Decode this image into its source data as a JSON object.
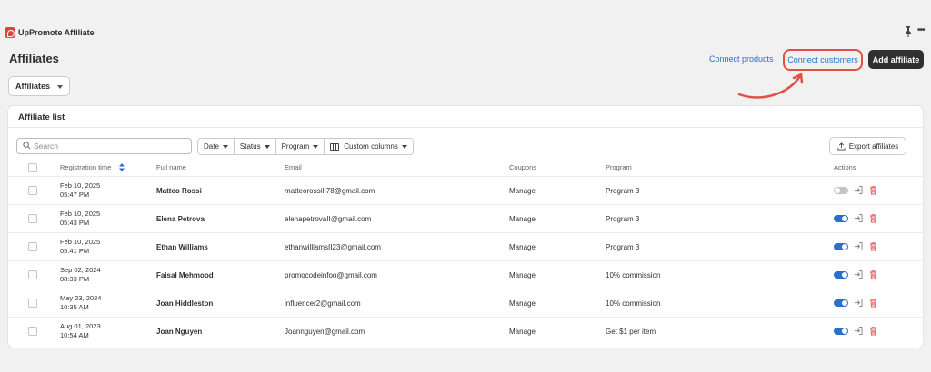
{
  "app": {
    "name": "UpPromote Affiliate",
    "logo_color": "#e0453a"
  },
  "header": {
    "title": "Affiliates",
    "connect_products": "Connect products",
    "connect_customers": "Connect customers",
    "add_affiliate": "Add affiliate"
  },
  "view_select": {
    "selected": "Affiliates"
  },
  "card": {
    "title": "Affiliate list",
    "search_placeholder": "Search",
    "filters": {
      "date": "Date",
      "status": "Status",
      "program": "Program",
      "custom_columns": "Custom columns"
    },
    "export": "Export affiliates",
    "columns": {
      "registration_time": "Registration time",
      "full_name": "Full name",
      "email": "Email",
      "coupons": "Coupons",
      "program": "Program",
      "actions": "Actions"
    },
    "rows": [
      {
        "date": "Feb 10, 2025",
        "time": "05:47 PM",
        "name": "Matteo Rossi",
        "email": "matteorossiII78@gmail.com",
        "coupons": "Manage",
        "program": "Program 3",
        "active": false
      },
      {
        "date": "Feb 10, 2025",
        "time": "05:43 PM",
        "name": "Elena Petrova",
        "email": "elenapetrovaII@gmail.com",
        "coupons": "Manage",
        "program": "Program 3",
        "active": true
      },
      {
        "date": "Feb 10, 2025",
        "time": "05:41 PM",
        "name": "Ethan Williams",
        "email": "ethanwilliamsII23@gmail.com",
        "coupons": "Manage",
        "program": "Program 3",
        "active": true
      },
      {
        "date": "Sep 02, 2024",
        "time": "08:33 PM",
        "name": "Faisal Mehmood",
        "email": "promocodeinfoo@gmail.com",
        "coupons": "Manage",
        "program": "10% commission",
        "active": true
      },
      {
        "date": "May 23, 2024",
        "time": "10:35 AM",
        "name": "Joan Hiddleston",
        "email": "influencer2@gmail.com",
        "coupons": "Manage",
        "program": "10% commission",
        "active": true
      },
      {
        "date": "Aug 01, 2023",
        "time": "10:54 AM",
        "name": "Joan Nguyen",
        "email": "Joannguyen@gmail.com",
        "coupons": "Manage",
        "program": "Get $1 per item",
        "active": true
      }
    ]
  },
  "colors": {
    "accent": "#2c6ecb",
    "highlight": "#e24f44",
    "primary_button": "#303030",
    "delete": "#e35b5b"
  }
}
